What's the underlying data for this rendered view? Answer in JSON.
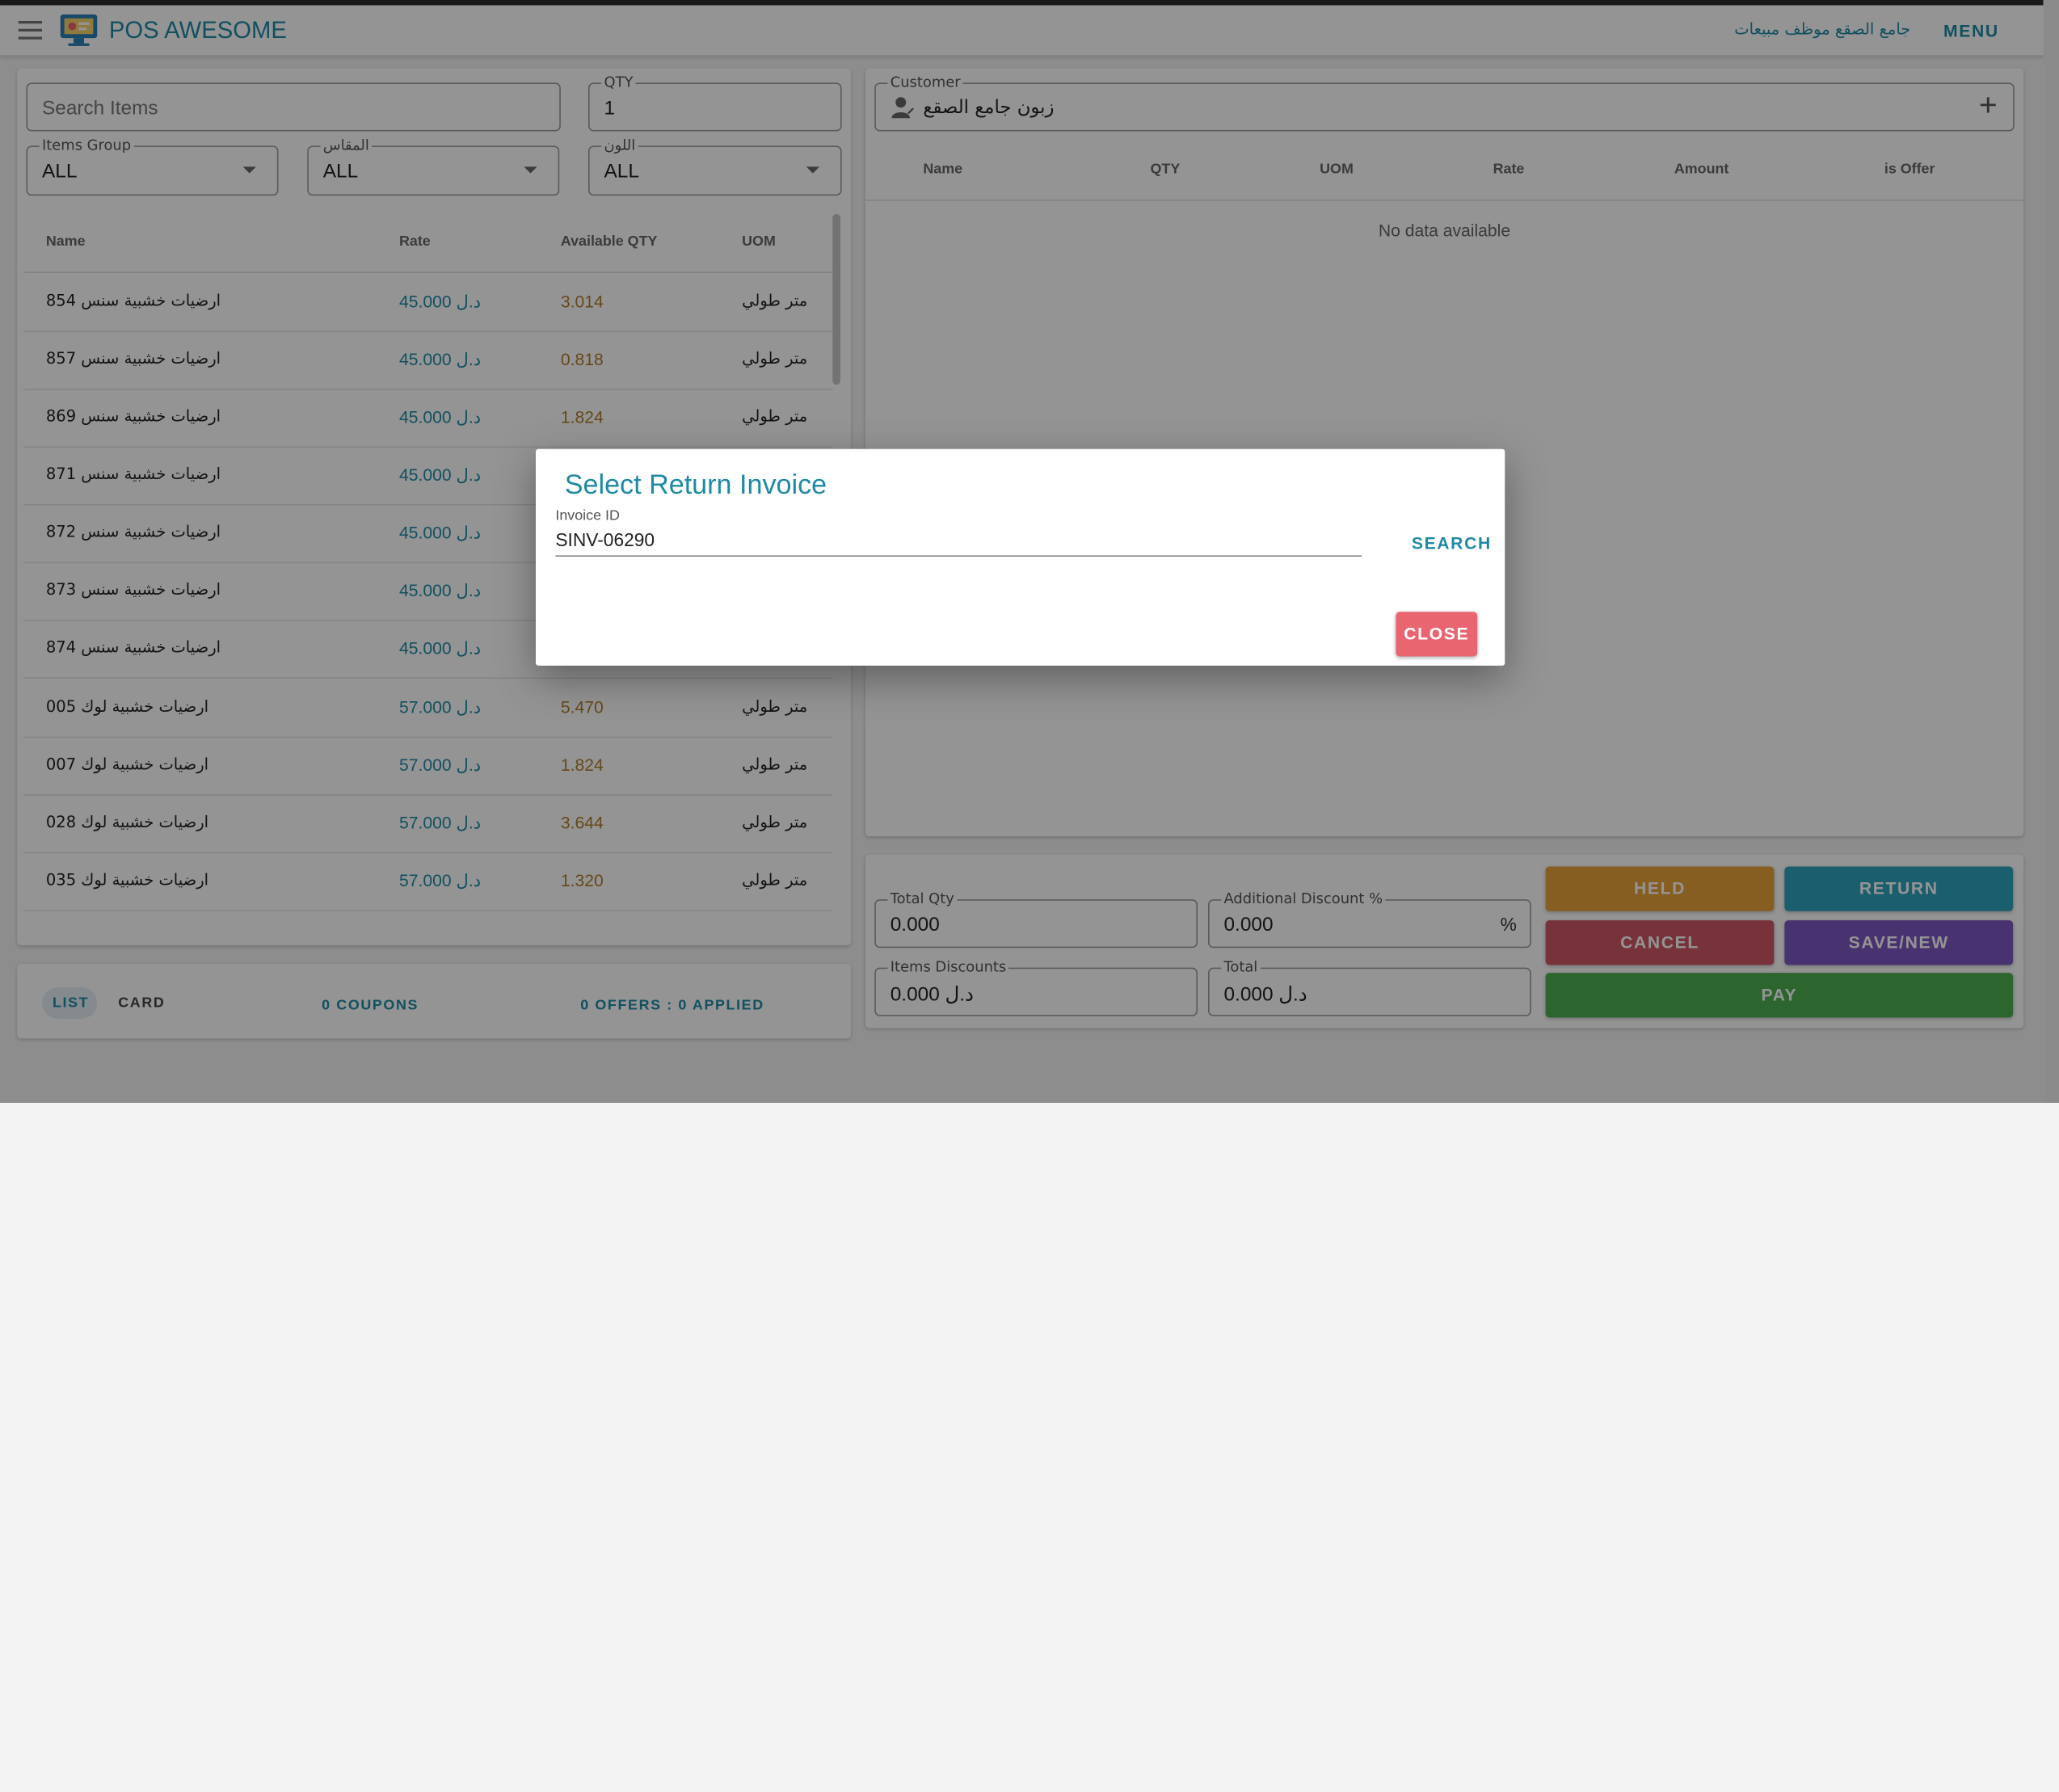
{
  "appbar": {
    "brand_part1": "POS ",
    "brand_part2": "AWESOME",
    "user": "جامع الصقع موظف مبيعات",
    "menu_label": "MENU"
  },
  "items_panel": {
    "search_placeholder": "Search Items",
    "qty_label": "QTY",
    "qty_value": "1",
    "filters": [
      {
        "label": "Items Group",
        "value": "ALL"
      },
      {
        "label": "المقاس",
        "value": "ALL"
      },
      {
        "label": "اللون",
        "value": "ALL"
      }
    ],
    "columns": [
      "Name",
      "Rate",
      "Available QTY",
      "UOM"
    ],
    "rows": [
      {
        "name": "ارضيات خشبية سنس 854",
        "rate": "45.000 د.ل",
        "qty": "3.014",
        "uom": "متر طولي"
      },
      {
        "name": "ارضيات خشبية سنس 857",
        "rate": "45.000 د.ل",
        "qty": "0.818",
        "uom": "متر طولي"
      },
      {
        "name": "ارضيات خشبية سنس 869",
        "rate": "45.000 د.ل",
        "qty": "1.824",
        "uom": "متر طولي"
      },
      {
        "name": "ارضيات خشبية سنس 871",
        "rate": "45.000 د.ل",
        "qty": "",
        "uom": ""
      },
      {
        "name": "ارضيات خشبية سنس 872",
        "rate": "45.000 د.ل",
        "qty": "",
        "uom": ""
      },
      {
        "name": "ارضيات خشبية سنس 873",
        "rate": "45.000 د.ل",
        "qty": "",
        "uom": ""
      },
      {
        "name": "ارضيات خشبية سنس 874",
        "rate": "45.000 د.ل",
        "qty": "",
        "uom": ""
      },
      {
        "name": "ارضيات خشبية لوك 005",
        "rate": "57.000 د.ل",
        "qty": "5.470",
        "uom": "متر طولي"
      },
      {
        "name": "ارضيات خشبية لوك 007",
        "rate": "57.000 د.ل",
        "qty": "1.824",
        "uom": "متر طولي"
      },
      {
        "name": "ارضيات خشبية لوك 028",
        "rate": "57.000 د.ل",
        "qty": "3.644",
        "uom": "متر طولي"
      },
      {
        "name": "ارضيات خشبية لوك 035",
        "rate": "57.000 د.ل",
        "qty": "1.320",
        "uom": "متر طولي"
      }
    ],
    "footer": {
      "list_label": "LIST",
      "card_label": "CARD",
      "coupons_label": "0 COUPONS",
      "offers_label": "0 OFFERS : 0 APPLIED"
    }
  },
  "invoice_panel": {
    "customer_label": "Customer",
    "customer_value": "زبون جامع الصقع",
    "columns": [
      "Name",
      "QTY",
      "UOM",
      "Rate",
      "Amount",
      "is Offer"
    ],
    "empty_text": "No data available"
  },
  "totals": {
    "total_qty_label": "Total Qty",
    "total_qty_value": "0.000",
    "additional_discount_label": "Additional Discount %",
    "additional_discount_value": "0.000",
    "percent_suffix": "%",
    "items_discounts_label": "Items Discounts",
    "items_discounts_value": "د.ل 0.000",
    "total_label": "Total",
    "total_value": "د.ل 0.000"
  },
  "actions": {
    "held": "HELD",
    "return": "RETURN",
    "cancel": "CANCEL",
    "save_new": "SAVE/NEW",
    "pay": "PAY"
  },
  "dialog": {
    "title": "Select Return Invoice",
    "invoice_label": "Invoice ID",
    "invoice_value": "SINV-06290",
    "search_label": "SEARCH",
    "close_label": "CLOSE"
  },
  "colors": {
    "accent": "#1f8aa5",
    "held": "#e8a33c",
    "return": "#2fa3bd",
    "cancel": "#cf5663",
    "save_new": "#7e57c2",
    "pay": "#4caf50",
    "close": "#e9656f"
  }
}
